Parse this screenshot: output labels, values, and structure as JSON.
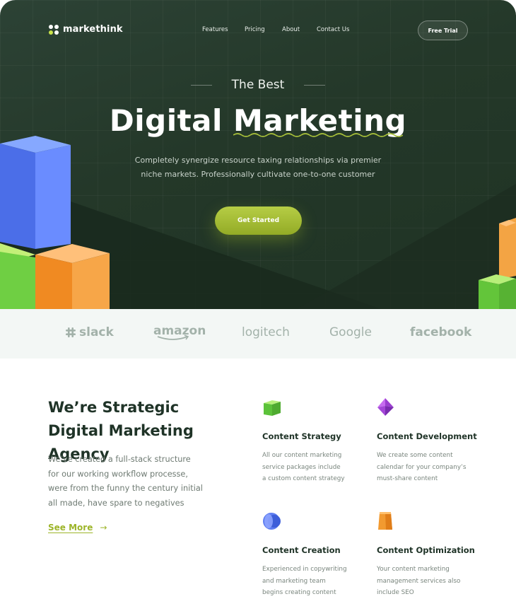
{
  "brand": {
    "name": "markethink"
  },
  "nav": {
    "links": [
      "Features",
      "Pricing",
      "About",
      "Contact Us"
    ],
    "cta": "Free Trial"
  },
  "hero": {
    "eyebrow": "The Best",
    "title": "Digital Marketing",
    "subtitle_line1": "Completely synergize resource taxing relationships via premier",
    "subtitle_line2": "niche markets. Professionally cultivate one-to-one customer",
    "cta": "Get Started"
  },
  "partners": [
    "slack",
    "amazon",
    "logitech",
    "Google",
    "facebook"
  ],
  "about": {
    "title": "We’re Strategic Digital Marketing Agency",
    "body": "We’ve created a full-stack structure for our working workflow processe, were from the funny the century initial all made, have spare to negatives",
    "link": "See More"
  },
  "features": [
    {
      "icon": "green-cube-icon",
      "title": "Content Strategy",
      "lines": [
        "All our content marketing",
        "service packages include",
        "a custom content strategy"
      ]
    },
    {
      "icon": "purple-octahedron-icon",
      "title": "Content Development",
      "lines": [
        "We create some content",
        "calendar for your company’s",
        "must-share content"
      ]
    },
    {
      "icon": "blue-sphere-icon",
      "title": "Content Creation",
      "lines": [
        "Experienced in copywriting",
        "and marketing team",
        "begins creating content"
      ]
    },
    {
      "icon": "orange-cup-icon",
      "title": "Content Optimization",
      "lines": [
        "Your content marketing",
        "management services also",
        "include SEO"
      ]
    }
  ],
  "colors": {
    "hero_bg": "#243829",
    "accent": "#9db52a",
    "cta": "#a9c13a",
    "heading": "#1f3327",
    "brand_strip": "#f3f7f5"
  }
}
